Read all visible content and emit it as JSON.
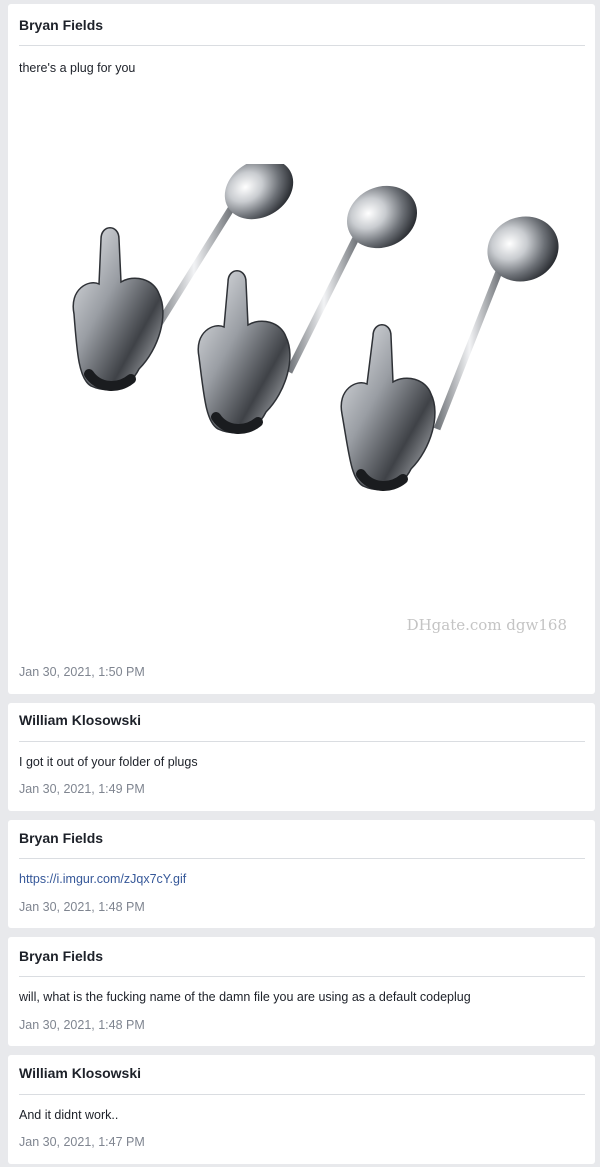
{
  "posts": [
    {
      "author": "Bryan Fields",
      "text": "there's a plug for you",
      "has_image": true,
      "image_watermark": "DHgate.com  dgw168",
      "timestamp": "Jan 30, 2021, 1:50 PM"
    },
    {
      "author": "William Klosowski",
      "text": "I got it out of your folder of plugs",
      "timestamp": "Jan 30, 2021, 1:49 PM"
    },
    {
      "author": "Bryan Fields",
      "text": "https://i.imgur.com/zJqx7cY.gif",
      "is_link": true,
      "timestamp": "Jan 30, 2021, 1:48 PM"
    },
    {
      "author": "Bryan Fields",
      "text": "will, what is the fucking name of the damn file you are using as a default codeplug",
      "timestamp": "Jan 30, 2021, 1:48 PM"
    },
    {
      "author": "William Klosowski",
      "text": "And it didnt work..",
      "timestamp": "Jan 30, 2021, 1:47 PM"
    }
  ],
  "colors": {
    "background": "#e8e9ec",
    "card": "#ffffff",
    "text": "#1d2129",
    "link": "#365899",
    "timestamp": "#7f8590",
    "divider": "#dadde1"
  }
}
